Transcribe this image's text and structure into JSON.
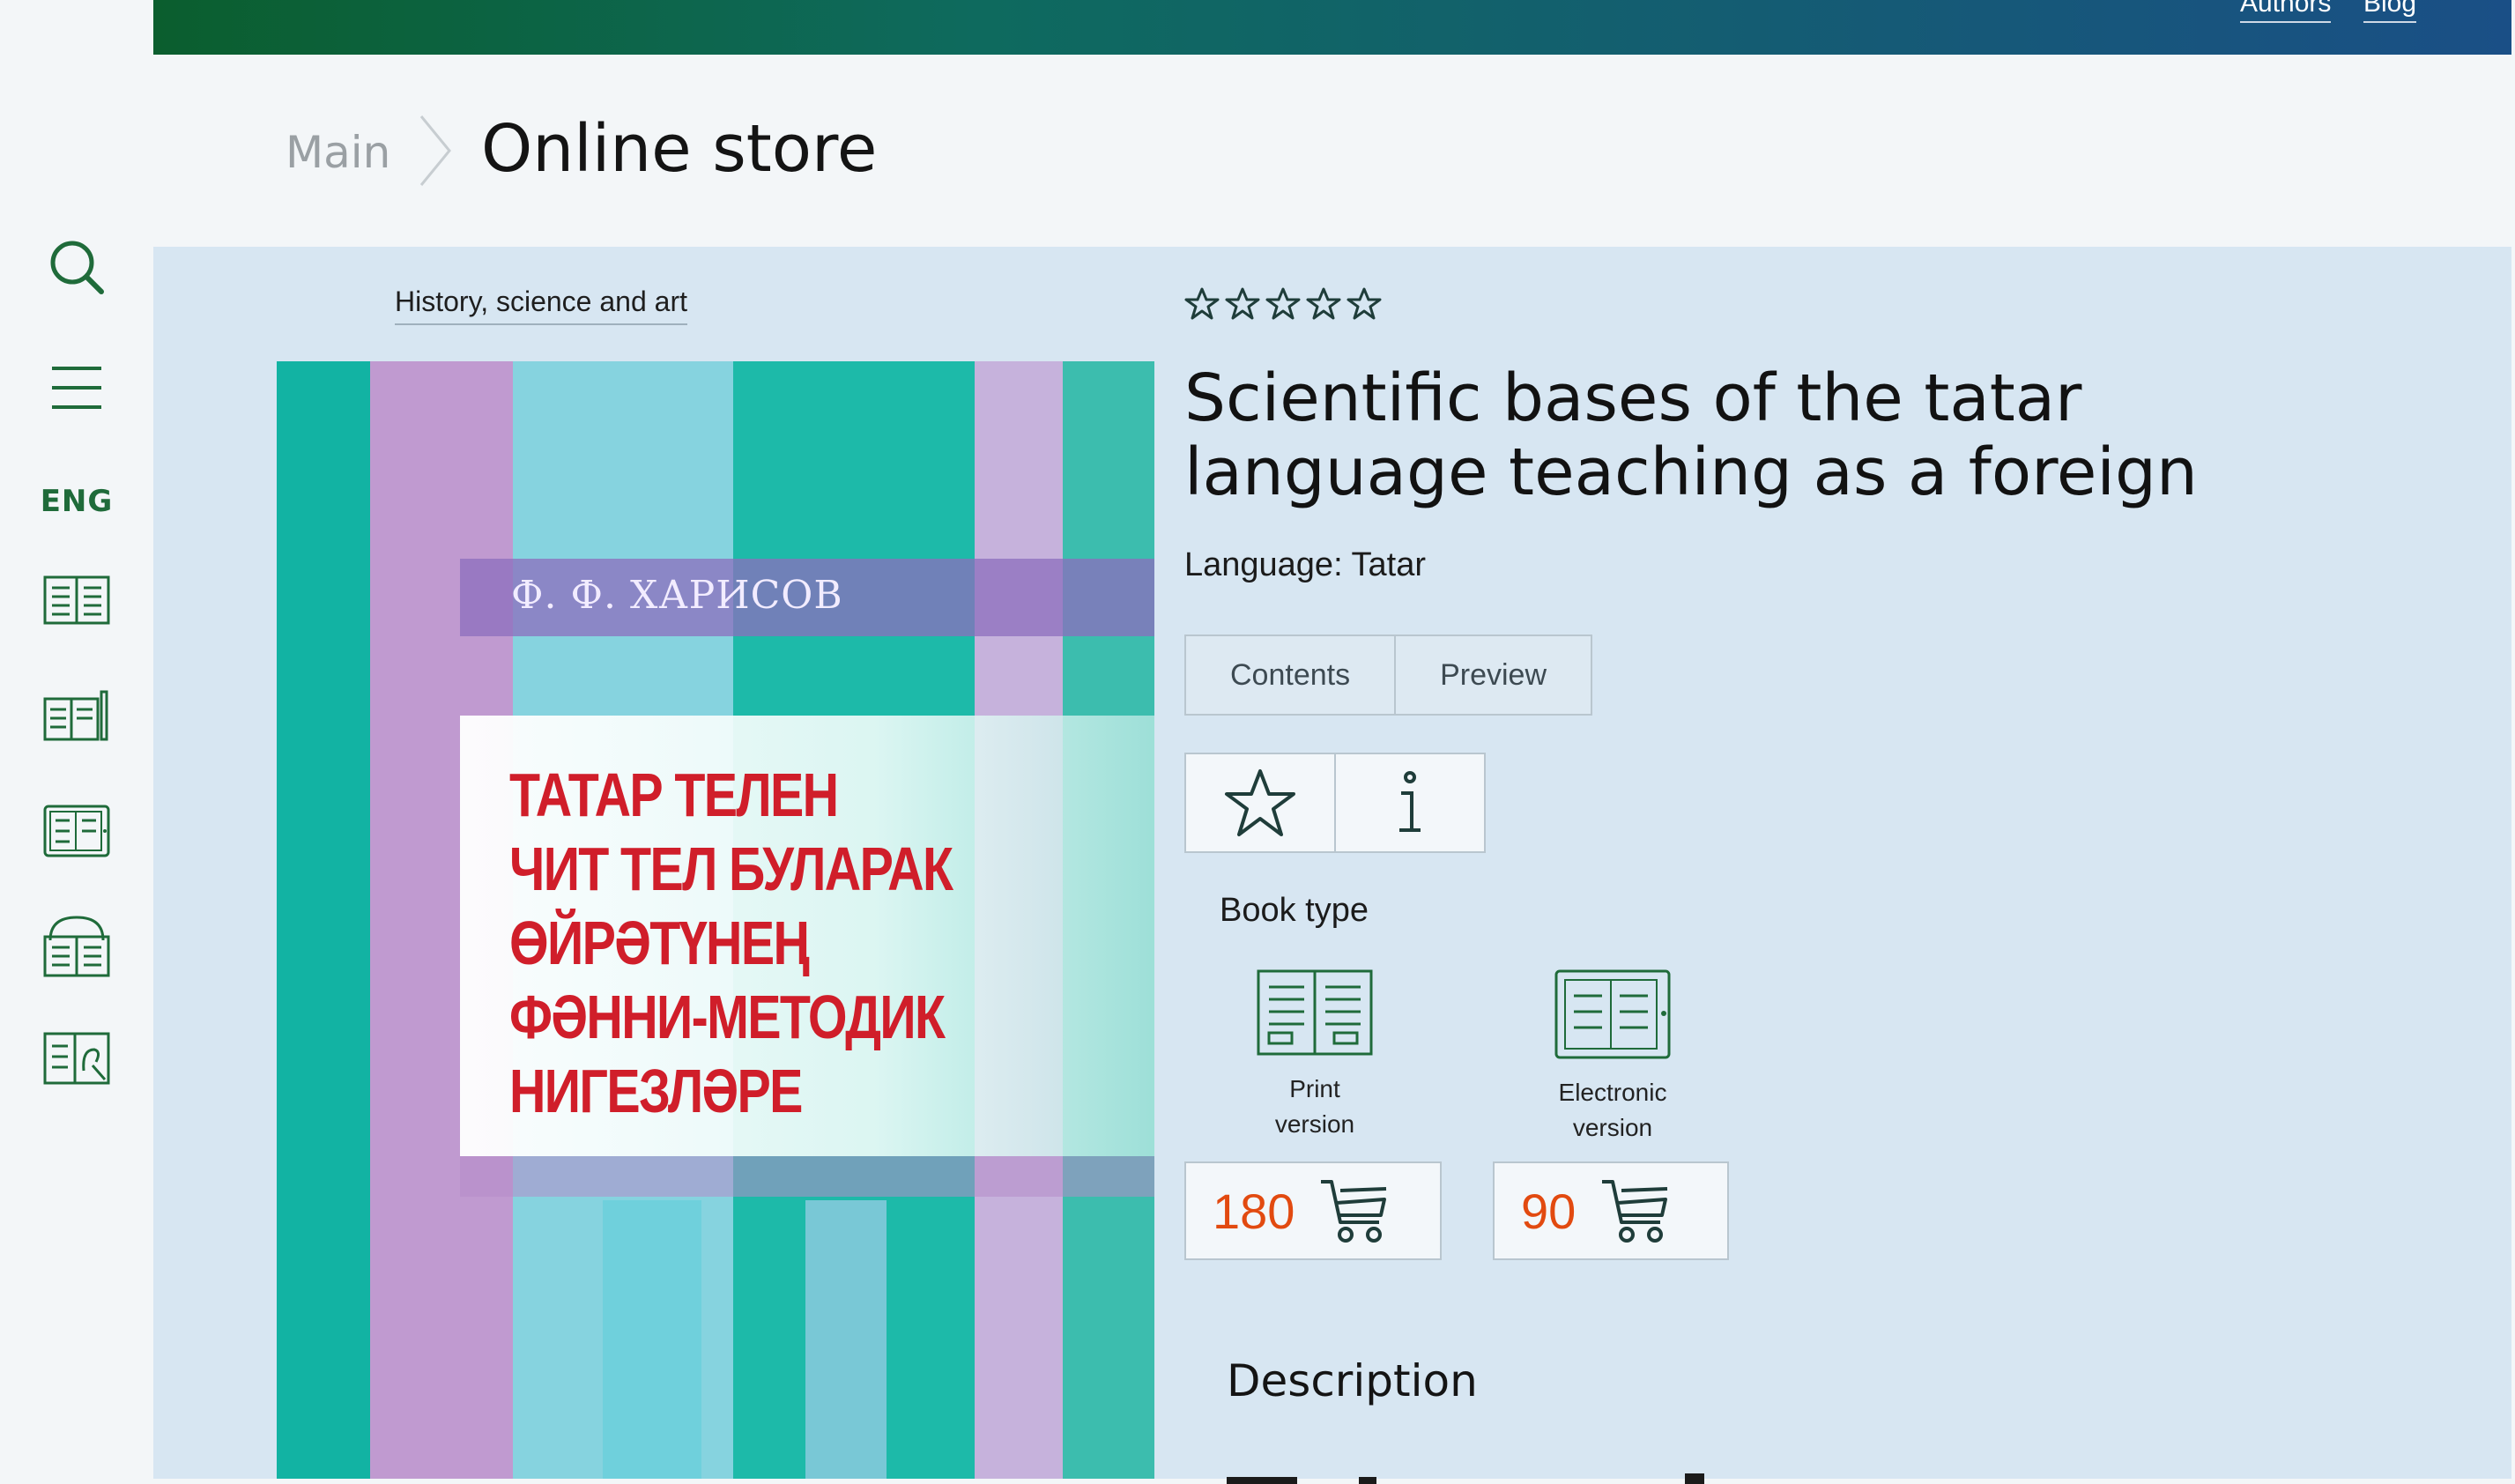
{
  "topnav": {
    "authors": "Authors",
    "blog": "Blog"
  },
  "sidebar": {
    "lang": "ENG",
    "icons": [
      "search-icon",
      "menu-icon",
      "print-book-icon",
      "book-pen-icon",
      "ebook-icon",
      "audiobook-icon",
      "ebook-stylus-icon"
    ]
  },
  "breadcrumb": {
    "main": "Main",
    "current": "Online store"
  },
  "book": {
    "category": "History, science and art",
    "rating": {
      "value": 0,
      "max": 5
    },
    "title_line1": "Scientific bases of the tatar",
    "title_line2": "language teaching as a foreign",
    "language_line": "Language: Tatar",
    "tabs": [
      "Contents",
      "Preview"
    ],
    "cover": {
      "author": "Ф. Ф. ХАРИСОВ",
      "title_lines": [
        "ТАТАР ТЕЛЕН",
        "ЧИТ ТЕЛ БУЛАРАК",
        "ӨЙРӘТҮНЕҢ",
        "ФӘННИ-МЕТОДИК",
        "НИГЕЗЛӘРЕ"
      ]
    },
    "book_type_label": "Book type",
    "variants": [
      {
        "line1": "Print",
        "line2": "version",
        "price": "180"
      },
      {
        "line1": "Electronic",
        "line2": "version",
        "price": "90"
      }
    ],
    "description_heading": "Description"
  },
  "colors": {
    "brand_green": "#1f6b3a",
    "price": "#e24a10",
    "content_bg": "#d7e6f2"
  }
}
